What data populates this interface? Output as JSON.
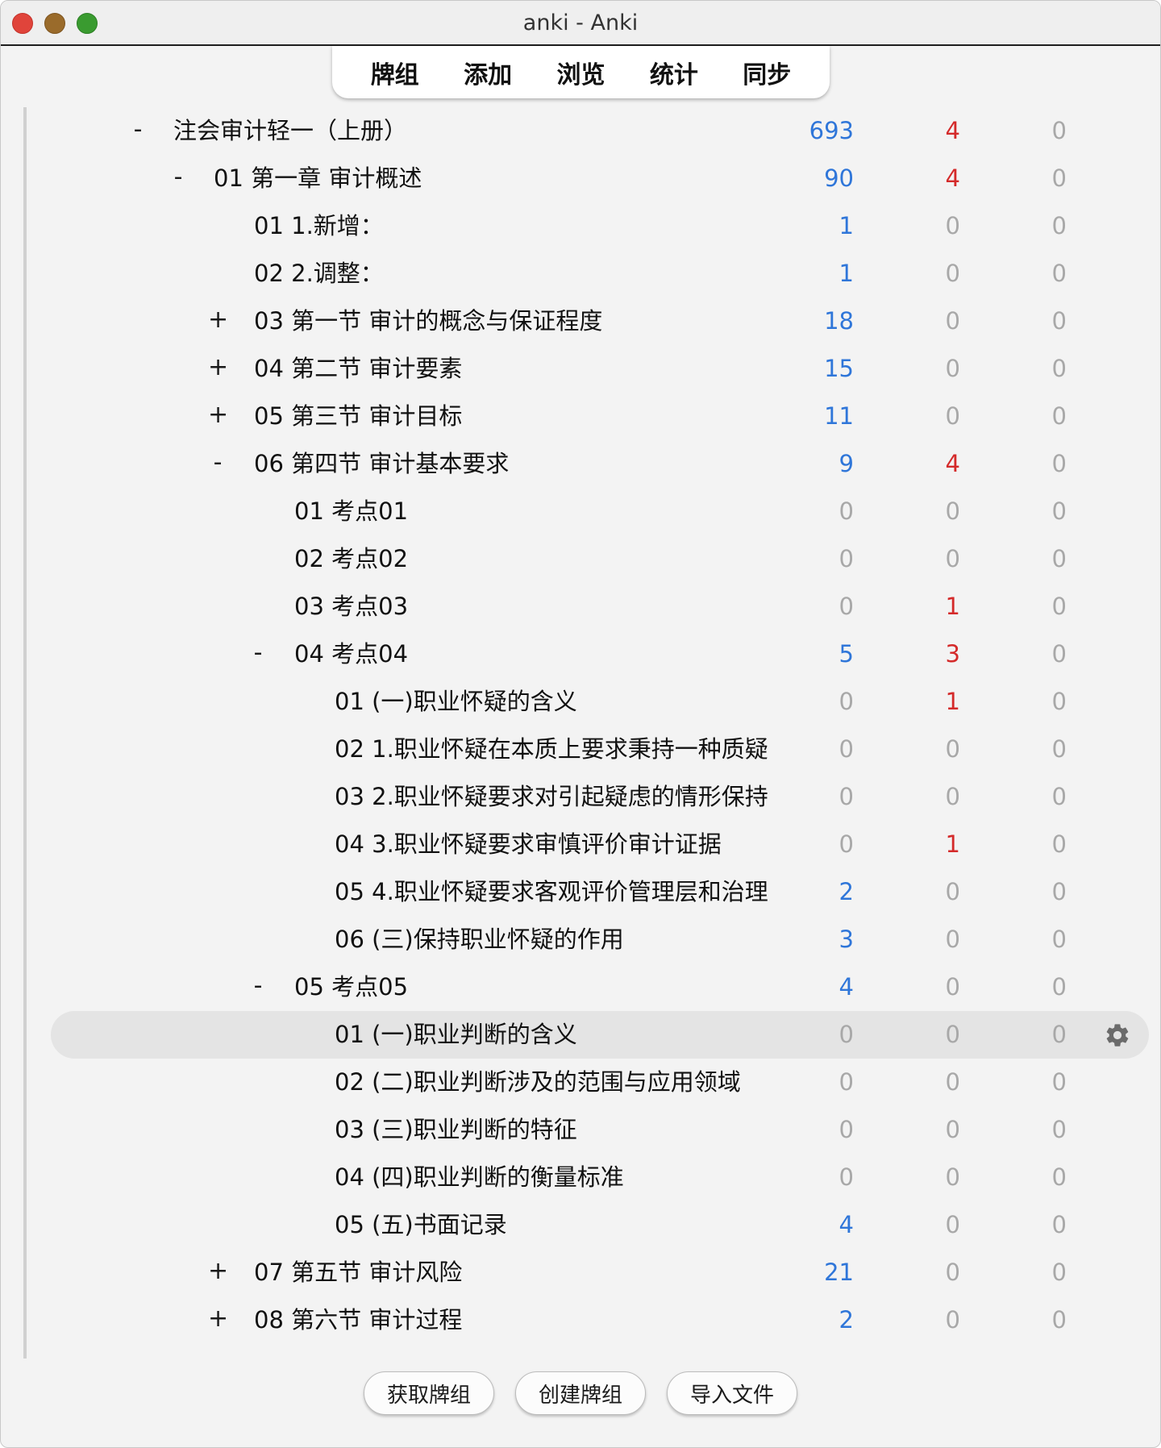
{
  "window": {
    "title": "anki - Anki"
  },
  "toolbar": {
    "items": [
      {
        "label": "牌组"
      },
      {
        "label": "添加"
      },
      {
        "label": "浏览"
      },
      {
        "label": "统计"
      },
      {
        "label": "同步"
      }
    ]
  },
  "colors": {
    "new": "#2f76d9",
    "learn": "#d42a2a",
    "zero": "#a8a8a8"
  },
  "decks": [
    {
      "name": "注会审计轻一（上册）",
      "level": 0,
      "toggle": "-",
      "new": "693",
      "learn": "4",
      "due": "0"
    },
    {
      "name": "01 第一章 审计概述",
      "level": 1,
      "toggle": "-",
      "new": "90",
      "learn": "4",
      "due": "0"
    },
    {
      "name": "01 1.新增：",
      "level": 2,
      "toggle": "",
      "new": "1",
      "learn": "0",
      "due": "0"
    },
    {
      "name": "02 2.调整：",
      "level": 2,
      "toggle": "",
      "new": "1",
      "learn": "0",
      "due": "0"
    },
    {
      "name": "03 第一节 审计的概念与保证程度",
      "level": 2,
      "toggle": "+",
      "new": "18",
      "learn": "0",
      "due": "0"
    },
    {
      "name": "04 第二节 审计要素",
      "level": 2,
      "toggle": "+",
      "new": "15",
      "learn": "0",
      "due": "0"
    },
    {
      "name": "05 第三节 审计目标",
      "level": 2,
      "toggle": "+",
      "new": "11",
      "learn": "0",
      "due": "0"
    },
    {
      "name": "06 第四节 审计基本要求",
      "level": 2,
      "toggle": "-",
      "new": "9",
      "learn": "4",
      "due": "0"
    },
    {
      "name": "01 考点01",
      "level": 3,
      "toggle": "",
      "new": "0",
      "learn": "0",
      "due": "0"
    },
    {
      "name": "02 考点02",
      "level": 3,
      "toggle": "",
      "new": "0",
      "learn": "0",
      "due": "0"
    },
    {
      "name": "03 考点03",
      "level": 3,
      "toggle": "",
      "new": "0",
      "learn": "1",
      "due": "0"
    },
    {
      "name": "04 考点04",
      "level": 3,
      "toggle": "-",
      "new": "5",
      "learn": "3",
      "due": "0"
    },
    {
      "name": "01 (一)职业怀疑的含义",
      "level": 4,
      "toggle": "",
      "new": "0",
      "learn": "1",
      "due": "0"
    },
    {
      "name": "02 1.职业怀疑在本质上要求秉持一种质疑",
      "level": 4,
      "toggle": "",
      "new": "0",
      "learn": "0",
      "due": "0"
    },
    {
      "name": "03 2.职业怀疑要求对引起疑虑的情形保持",
      "level": 4,
      "toggle": "",
      "new": "0",
      "learn": "0",
      "due": "0"
    },
    {
      "name": "04 3.职业怀疑要求审慎评价审计证据",
      "level": 4,
      "toggle": "",
      "new": "0",
      "learn": "1",
      "due": "0"
    },
    {
      "name": "05 4.职业怀疑要求客观评价管理层和治理",
      "level": 4,
      "toggle": "",
      "new": "2",
      "learn": "0",
      "due": "0"
    },
    {
      "name": "06 (三)保持职业怀疑的作用",
      "level": 4,
      "toggle": "",
      "new": "3",
      "learn": "0",
      "due": "0"
    },
    {
      "name": "05 考点05",
      "level": 3,
      "toggle": "-",
      "new": "4",
      "learn": "0",
      "due": "0"
    },
    {
      "name": "01 (一)职业判断的含义",
      "level": 4,
      "toggle": "",
      "new": "0",
      "learn": "0",
      "due": "0",
      "current": true
    },
    {
      "name": "02 (二)职业判断涉及的范围与应用领域",
      "level": 4,
      "toggle": "",
      "new": "0",
      "learn": "0",
      "due": "0"
    },
    {
      "name": "03 (三)职业判断的特征",
      "level": 4,
      "toggle": "",
      "new": "0",
      "learn": "0",
      "due": "0"
    },
    {
      "name": "04 (四)职业判断的衡量标准",
      "level": 4,
      "toggle": "",
      "new": "0",
      "learn": "0",
      "due": "0"
    },
    {
      "name": "05 (五)书面记录",
      "level": 4,
      "toggle": "",
      "new": "4",
      "learn": "0",
      "due": "0"
    },
    {
      "name": "07 第五节 审计风险",
      "level": 2,
      "toggle": "+",
      "new": "21",
      "learn": "0",
      "due": "0"
    },
    {
      "name": "08 第六节 审计过程",
      "level": 2,
      "toggle": "+",
      "new": "2",
      "learn": "0",
      "due": "0"
    }
  ],
  "bottom": {
    "get_shared": "获取牌组",
    "create_deck": "创建牌组",
    "import_file": "导入文件"
  },
  "icons": {
    "deck_options": "gear-icon"
  }
}
